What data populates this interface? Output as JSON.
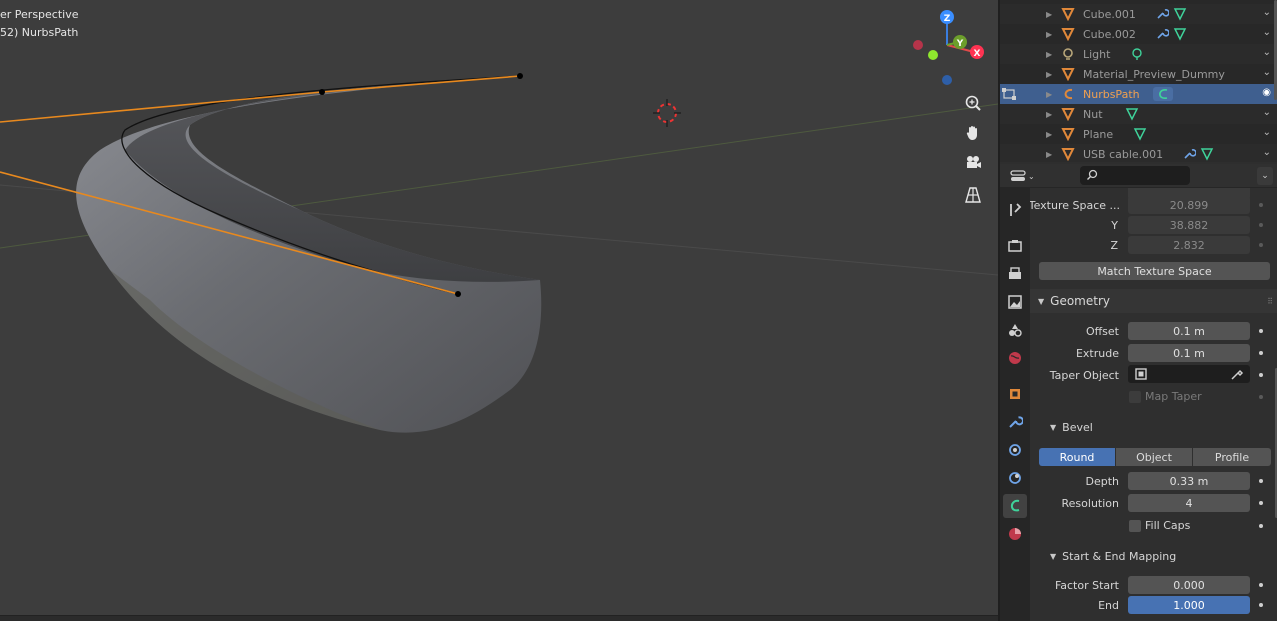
{
  "viewport": {
    "view_name": "er Perspective",
    "object_info": "52) NurbsPath"
  },
  "outliner": {
    "items": [
      {
        "name": "Cube.001",
        "type": "mesh",
        "mods": [
          "wrench-icon",
          "mesh-data-icon"
        ],
        "selected": false
      },
      {
        "name": "Cube.002",
        "type": "mesh",
        "mods": [
          "wrench-icon",
          "mesh-data-icon"
        ],
        "selected": false
      },
      {
        "name": "Light",
        "type": "light",
        "mods": [
          "light-data-icon"
        ],
        "selected": false
      },
      {
        "name": "Material_Preview_Dummy",
        "type": "mesh",
        "mods": [],
        "selected": false
      },
      {
        "name": "NurbsPath",
        "type": "curve",
        "mods": [
          "curve-data-icon"
        ],
        "selected": true
      },
      {
        "name": "Nut",
        "type": "mesh",
        "mods": [
          "mesh-data-icon"
        ],
        "selected": false
      },
      {
        "name": "Plane",
        "type": "mesh",
        "mods": [
          "mesh-data-icon"
        ],
        "selected": false
      },
      {
        "name": "USB cable.001",
        "type": "mesh",
        "mods": [
          "wrench-icon",
          "mesh-data-icon"
        ],
        "selected": false
      }
    ]
  },
  "properties": {
    "search_placeholder": "",
    "texture_space": {
      "label": "Texture Space ...",
      "x": "20.899",
      "y_label": "Y",
      "y": "38.882",
      "z_label": "Z",
      "z": "2.832"
    },
    "match_texture_space": "Match Texture Space",
    "geometry": {
      "title": "Geometry",
      "offset_label": "Offset",
      "offset": "0.1 m",
      "extrude_label": "Extrude",
      "extrude": "0.1 m",
      "taper_label": "Taper Object",
      "map_taper": "Map Taper"
    },
    "bevel": {
      "title": "Bevel",
      "modes": [
        "Round",
        "Object",
        "Profile"
      ],
      "active_mode": "Round",
      "depth_label": "Depth",
      "depth": "0.33 m",
      "resolution_label": "Resolution",
      "resolution": "4",
      "fill_caps": "Fill Caps"
    },
    "mapping": {
      "title": "Start & End Mapping",
      "factor_start_label": "Factor Start",
      "factor_start": "0.000",
      "end_label": "End",
      "end": "1.000"
    }
  },
  "colors": {
    "accent": "#4772b3",
    "selection_orange": "#f0a050",
    "curve_orange": "#e8891e",
    "data_green": "#3fd29a"
  }
}
